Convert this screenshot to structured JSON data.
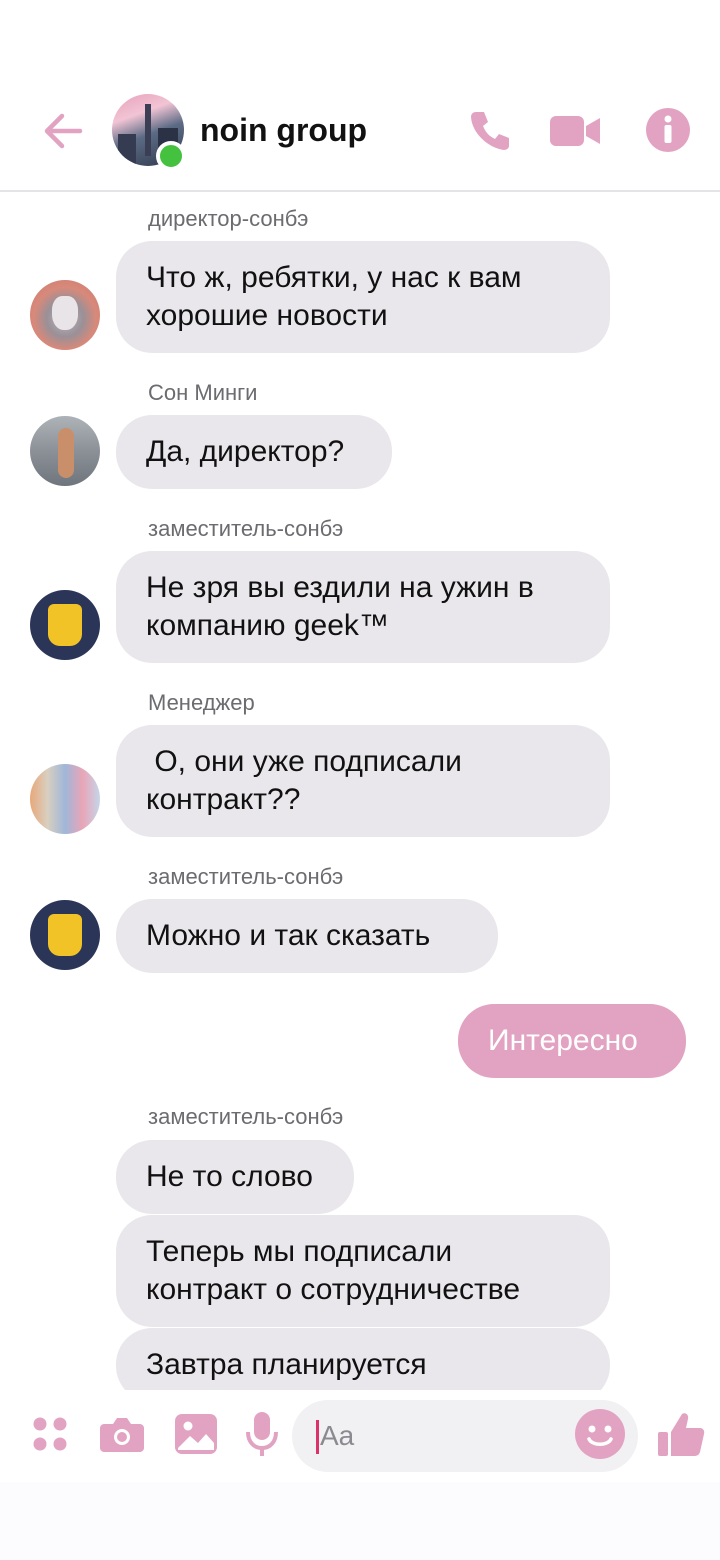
{
  "header": {
    "title": "noin group",
    "accent_color": "#e2a3c2",
    "icons": [
      "back-arrow-icon",
      "phone-icon",
      "video-camera-icon",
      "info-icon"
    ]
  },
  "messages": [
    {
      "sender": "директор-сонбэ",
      "text": "Что ж, ребятки, у нас к вам хорошие новости"
    },
    {
      "sender": "Сон Минги",
      "text": "Да, директор?"
    },
    {
      "sender": "заместитель-сонбэ",
      "text": "Не зря вы ездили на ужин в компанию geek™"
    },
    {
      "sender": "Менеджер",
      "text": " О, они уже подписали контракт??"
    },
    {
      "sender": "заместитель-сонбэ",
      "text": "Можно и так сказать"
    },
    {
      "sender": "",
      "text": "Интересно",
      "mine": true
    },
    {
      "sender": "заместитель-сонбэ",
      "text": "Не то слово"
    },
    {
      "sender": "",
      "text": "Теперь мы подписали контракт о сотрудничестве"
    },
    {
      "sender": "",
      "text": "Завтра планируется"
    }
  ],
  "composer": {
    "placeholder": "Aa",
    "icons": [
      "apps-grid-icon",
      "camera-icon",
      "image-icon",
      "microphone-icon",
      "emoji-icon",
      "thumbs-up-icon"
    ]
  }
}
